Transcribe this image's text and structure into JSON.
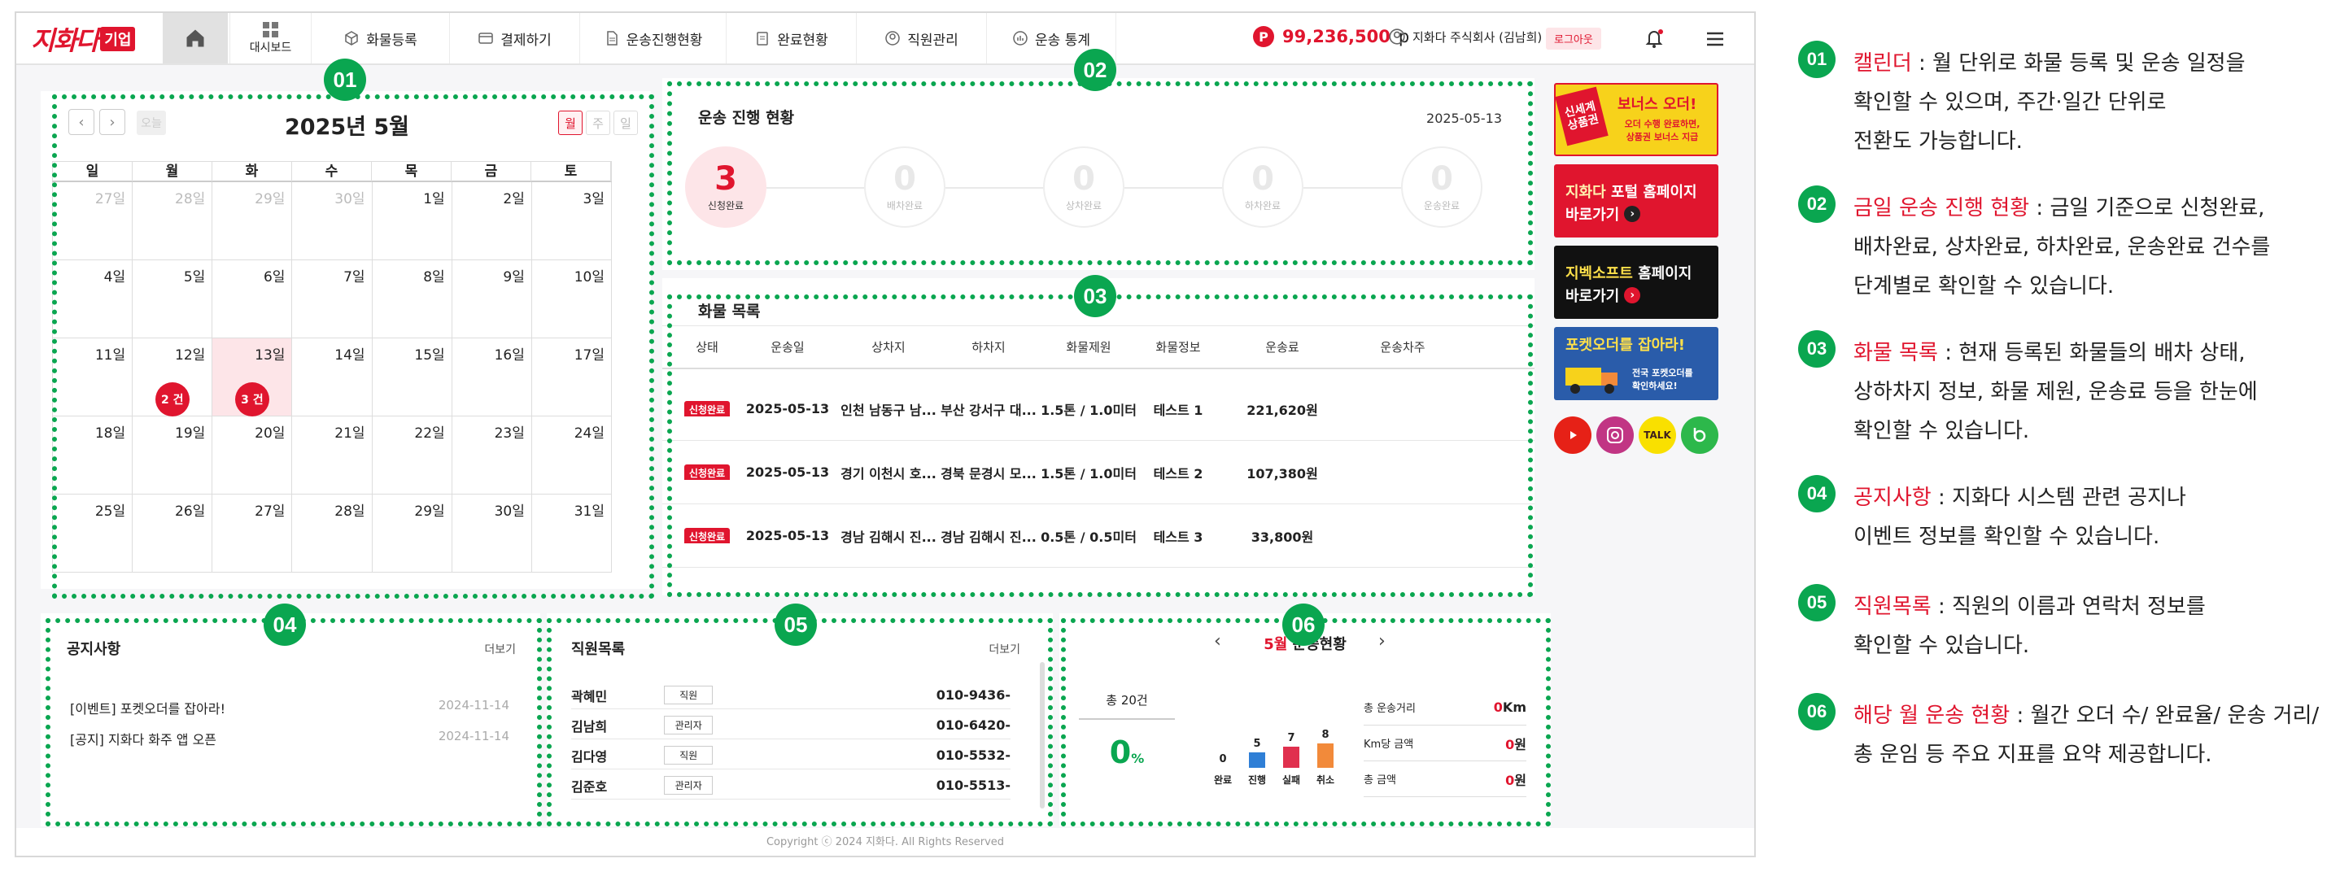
{
  "header": {
    "logo_text": "지화다",
    "logo_badge": "기업",
    "dashboard_label": "대시보드",
    "nav": [
      "화물등록",
      "결제하기",
      "운송진행현황",
      "완료현황",
      "직원관리",
      "운송 통계"
    ],
    "points": "99,236,500",
    "points_unit": "p",
    "points_icon": "P",
    "company": "지화다 주식회사 (김남희)",
    "logout": "로그아웃"
  },
  "calendar": {
    "title": "2025년 5월",
    "today_label": "오늘",
    "views": [
      "월",
      "주",
      "일"
    ],
    "weekdays": [
      "일",
      "월",
      "화",
      "수",
      "목",
      "금",
      "토"
    ],
    "days": [
      {
        "d": "27일",
        "dim": true
      },
      {
        "d": "28일",
        "dim": true
      },
      {
        "d": "29일",
        "dim": true
      },
      {
        "d": "30일",
        "dim": true
      },
      {
        "d": "1일"
      },
      {
        "d": "2일"
      },
      {
        "d": "3일"
      },
      {
        "d": "4일"
      },
      {
        "d": "5일"
      },
      {
        "d": "6일"
      },
      {
        "d": "7일"
      },
      {
        "d": "8일"
      },
      {
        "d": "9일"
      },
      {
        "d": "10일"
      },
      {
        "d": "11일"
      },
      {
        "d": "12일",
        "badge": "2 건"
      },
      {
        "d": "13일",
        "badge": "3 건",
        "today": true
      },
      {
        "d": "14일"
      },
      {
        "d": "15일"
      },
      {
        "d": "16일"
      },
      {
        "d": "17일"
      },
      {
        "d": "18일"
      },
      {
        "d": "19일"
      },
      {
        "d": "20일"
      },
      {
        "d": "21일"
      },
      {
        "d": "22일"
      },
      {
        "d": "23일"
      },
      {
        "d": "24일"
      },
      {
        "d": "25일"
      },
      {
        "d": "26일"
      },
      {
        "d": "27일"
      },
      {
        "d": "28일"
      },
      {
        "d": "29일"
      },
      {
        "d": "30일"
      },
      {
        "d": "31일"
      }
    ]
  },
  "progress": {
    "title": "운송 진행 현황",
    "date": "2025-05-13",
    "steps": [
      {
        "n": "3",
        "label": "신청완료"
      },
      {
        "n": "0",
        "label": "배차완료"
      },
      {
        "n": "0",
        "label": "상차완료"
      },
      {
        "n": "0",
        "label": "하차완료"
      },
      {
        "n": "0",
        "label": "운송완료"
      }
    ]
  },
  "cargo": {
    "title": "화물 목록",
    "columns": [
      "상태",
      "운송일",
      "상차지",
      "하차지",
      "화물제원",
      "화물정보",
      "운송료",
      "운송차주"
    ],
    "rows": [
      [
        "신청완료",
        "2025-05-13",
        "인천 남동구 남...",
        "부산 강서구 대...",
        "1.5톤 / 1.0미터",
        "테스트 1",
        "221,620원",
        ""
      ],
      [
        "신청완료",
        "2025-05-13",
        "경기 이천시 호...",
        "경북 문경시 모...",
        "1.5톤 / 1.0미터",
        "테스트 2",
        "107,380원",
        ""
      ],
      [
        "신청완료",
        "2025-05-13",
        "경남 김해시 진...",
        "경남 김해시 진...",
        "0.5톤 / 0.5미터",
        "테스트 3",
        "33,800원",
        ""
      ]
    ]
  },
  "notice": {
    "title": "공지사항",
    "more": "더보기",
    "items": [
      {
        "text": "[이벤트] 포켓오더를 잡아라!",
        "date": "2024-11-14"
      },
      {
        "text": "[공지] 지화다 화주 앱 오픈",
        "date": "2024-11-14"
      }
    ]
  },
  "staff": {
    "title": "직원목록",
    "more": "더보기",
    "rows": [
      {
        "name": "곽혜민",
        "role": "직원",
        "phone": "010-9436-"
      },
      {
        "name": "김남희",
        "role": "관리자",
        "phone": "010-6420-"
      },
      {
        "name": "김다영",
        "role": "직원",
        "phone": "010-5532-"
      },
      {
        "name": "김준호",
        "role": "관리자",
        "phone": "010-5513-"
      }
    ]
  },
  "monthly": {
    "month": "5월",
    "title": "운송현황",
    "total": "총 20건",
    "percent": "0",
    "percent_unit": "%",
    "bars": [
      {
        "label": "완료",
        "value": 0,
        "color": "#cccccc"
      },
      {
        "label": "진행",
        "value": 5,
        "color": "#2f7fd6"
      },
      {
        "label": "실패",
        "value": 7,
        "color": "#e0304e"
      },
      {
        "label": "취소",
        "value": 8,
        "color": "#f28a3a"
      }
    ],
    "kpis": [
      {
        "label": "총 운송거리",
        "value": "0",
        "unit": "Km"
      },
      {
        "label": "Km당 금액",
        "value": "0",
        "unit": "원"
      },
      {
        "label": "총 금액",
        "value": "0",
        "unit": "원"
      }
    ]
  },
  "banners": {
    "b1_tag": "신세계 상품권",
    "b1_title": "보너스 오더!",
    "b1_sub1": "오더 수행 완료하면,",
    "b1_sub2": "상품권 보너스 지급",
    "b2_line1_a": "지화다",
    "b2_line1_b": " 포털 홈페이지",
    "b2_line2": "바로가기",
    "b3_line1_a": "지벡소프트",
    "b3_line1_b": " 홈페이지",
    "b3_line2": "바로가기",
    "b4_title": "포켓오더를 잡아라!",
    "b4_sub1": "전국 포켓오더를",
    "b4_sub2": "확인하세요!",
    "sns": [
      "youtube-icon",
      "instagram-icon",
      "kakaotalk-icon",
      "blog-icon"
    ],
    "sns_talk": "TALK"
  },
  "footer": {
    "copyright": "Copyright ⓒ 2024 지화다. All Rights Reserved"
  },
  "markers": [
    "01",
    "02",
    "03",
    "04",
    "05",
    "06"
  ],
  "descriptions": [
    {
      "num": "01",
      "head": "캘린더",
      "body1": " : 월 단위로 화물 등록 및 운송 일정을",
      "body2": "확인할 수 있으며, 주간·일간 단위로",
      "body3": "전환도 가능합니다."
    },
    {
      "num": "02",
      "head": "금일 운송 진행 현황",
      "body1": " : 금일 기준으로 신청완료,",
      "body2": "배차완료, 상차완료, 하차완료, 운송완료 건수를",
      "body3": "단계별로 확인할 수 있습니다."
    },
    {
      "num": "03",
      "head": "화물 목록",
      "body1": " : 현재 등록된 화물들의 배차 상태,",
      "body2": "상하차지 정보, 화물 제원, 운송료 등을 한눈에",
      "body3": "확인할 수 있습니다."
    },
    {
      "num": "04",
      "head": "공지사항",
      "body1": " : 지화다 시스템 관련 공지나",
      "body2": "이벤트 정보를 확인할 수 있습니다.",
      "body3": ""
    },
    {
      "num": "05",
      "head": "직원목록",
      "body1": " : 직원의 이름과 연락처 정보를",
      "body2": "확인할 수 있습니다.",
      "body3": ""
    },
    {
      "num": "06",
      "head": "해당 월 운송 현황",
      "body1": " : 월간 오더 수/ 완료율/ 운송 거리/",
      "body2": "총 운임 등 주요 지표를 요약 제공합니다.",
      "body3": ""
    }
  ],
  "colors": {
    "brand": "#e0152e",
    "marker": "#0aa650"
  }
}
